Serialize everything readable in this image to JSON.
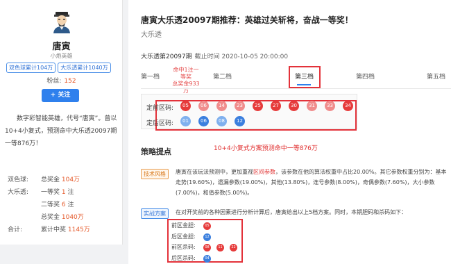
{
  "profile": {
    "name": "唐寅",
    "title": "小炮英雄",
    "badges": [
      "双色球累计104万",
      "大乐透累计1040万"
    ],
    "fans_label": "粉丝:",
    "fans_count": "152",
    "follow_label": "+ 关注",
    "description": "数字彩智能英雄，代号“唐寅”。曾以10+4小复式，预测命中大乐透20097期一等876万！",
    "stats": [
      {
        "k": "双色球:",
        "pre": "总奖金 ",
        "hl": "104万",
        "post": ""
      },
      {
        "k": "大乐透:",
        "pre": "一等奖 ",
        "hl": "1",
        "post": " 注"
      },
      {
        "k": "",
        "pre": "二等奖 ",
        "hl": "6",
        "post": " 注"
      },
      {
        "k": "",
        "pre": "总奖金 ",
        "hl": "1040万",
        "post": ""
      },
      {
        "k": "合计:",
        "pre": "累计中奖 ",
        "hl": "1145万",
        "post": ""
      }
    ]
  },
  "article": {
    "title": "唐寅大乐透20097期推荐：英雄过关斩将，奋战一等奖！",
    "category": "大乐透",
    "issue": "大乐透第20097期",
    "deadline": "截止时间 2020-10-05 20:00:00"
  },
  "tabs": {
    "items": [
      "第一档",
      "第二档",
      "第三档",
      "第四档",
      "第五档"
    ],
    "tip_line1": "命中1注一等奖",
    "tip_line2": "总奖金933万",
    "active": "第三档"
  },
  "numbers": {
    "front_label": "定前区码:",
    "back_label": "定后区码:",
    "front": [
      "05",
      "06",
      "14",
      "23",
      "25",
      "27",
      "30",
      "31",
      "33",
      "34"
    ],
    "front_hit": [
      true,
      false,
      false,
      false,
      true,
      true,
      true,
      false,
      false,
      true
    ],
    "back": [
      "01",
      "06",
      "08",
      "12"
    ],
    "back_hit": [
      false,
      true,
      false,
      true
    ]
  },
  "strategy": {
    "heading": "策略提点",
    "note": "10+4小复式方案预测命中一等876万",
    "tag1": "技术风格",
    "para1_pre": "唐寅在该玩法预测中，更加重视",
    "para1_hl": "区间参数",
    "para1_post": "，该参数在他的算法权重中占比20.00%。其它参数权重分别为：基本走势(19.60%)，遗漏参数(19.00%)，其他(13.80%)，连号参数(8.00%)，奇偶参数(7.60%)，大小参数(7.00%)，和值参数(5.00%)。",
    "tag2": "实战方案",
    "para2": "在对开奖前的各种因素进行分析计算后，唐寅给出以上5档方案。同时，本期胆码和杀码如下：",
    "results": [
      {
        "label": "前区金胆:",
        "balls": [
          "05"
        ],
        "color": "red"
      },
      {
        "label": "后区金胆:",
        "balls": [
          "12"
        ],
        "color": "blue"
      },
      {
        "label": "前区杀码:",
        "balls": [
          "08",
          "11",
          "22"
        ],
        "color": "red"
      },
      {
        "label": "后区杀码:",
        "balls": [
          "04"
        ],
        "color": "blue"
      }
    ]
  },
  "colors": {
    "accent": "#2f80ed",
    "red": "#e63b3b",
    "highlight_box": "#e3323a"
  }
}
